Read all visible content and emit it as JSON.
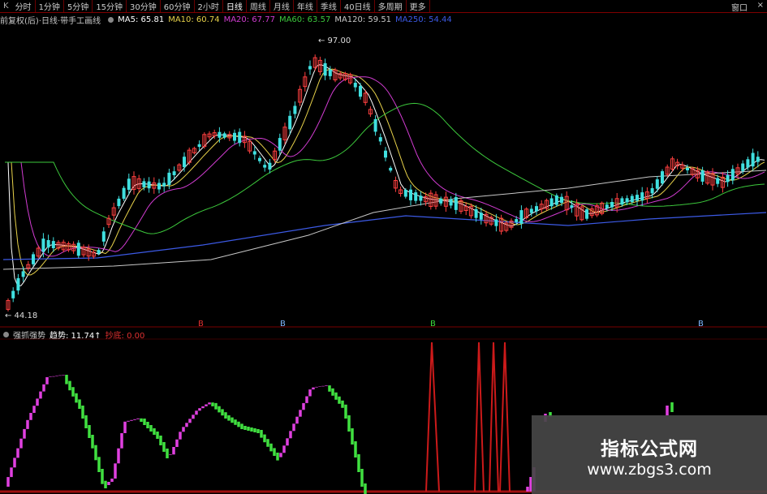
{
  "toolbar": {
    "lead": "K",
    "timeframes": [
      "分时",
      "1分钟",
      "5分钟",
      "15分钟",
      "30分钟",
      "60分钟",
      "2小时",
      "日线",
      "周线",
      "月线",
      "年线",
      "季线",
      "40日线",
      "多周期"
    ],
    "active_index": 7,
    "more_label": "更多",
    "window_label": "窗口",
    "close_label": "×"
  },
  "main_legend": {
    "title": "前复权(后)·日线·带手工画线",
    "items": [
      {
        "text": "MA5: 65.81",
        "color": "#ffffff"
      },
      {
        "text": "MA10: 60.74",
        "color": "#e8d24a"
      },
      {
        "text": "MA20: 67.77",
        "color": "#d23cd2"
      },
      {
        "text": "MA60: 63.57",
        "color": "#3cc83c"
      },
      {
        "text": "MA120: 59.51",
        "color": "#c8c8c8"
      },
      {
        "text": "MA250: 54.44",
        "color": "#3c5ae6"
      }
    ]
  },
  "annotations": {
    "high": "97.00",
    "low": "44.18"
  },
  "signal_markers": [
    {
      "text": "B",
      "color": "#e03030"
    },
    {
      "text": "B",
      "color": "#7fb6ff"
    },
    {
      "text": "B",
      "color": "#3cdc3c"
    },
    {
      "text": "B",
      "color": "#7fb6ff"
    }
  ],
  "indicator_legend": {
    "name": "强抓强势",
    "items": [
      {
        "text": "趋势: 11.74↑",
        "color": "#ffffff"
      },
      {
        "text": "抄底: 0.00",
        "color": "#e03030"
      }
    ]
  },
  "watermark": {
    "title": "指标公式网",
    "url": "www.zbgs3.com"
  },
  "colors": {
    "up": "#ff4040",
    "down": "#40e0e0",
    "rise_osc": "#e040e0",
    "fall_osc": "#40e040",
    "spike": "#cc1a1a"
  }
}
